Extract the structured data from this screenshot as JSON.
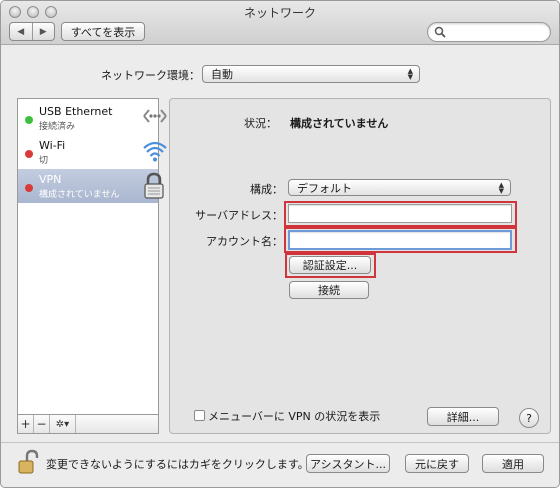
{
  "window": {
    "title": "ネットワーク"
  },
  "toolbar": {
    "show_all_label": "すべてを表示",
    "search_placeholder": ""
  },
  "location": {
    "label": "ネットワーク環境：",
    "value": "自動"
  },
  "sidebar": {
    "services": [
      {
        "name": "USB Ethernet",
        "status": "接続済み",
        "dot_color": "#3fbf3f",
        "icon": "ethernet-icon"
      },
      {
        "name": "Wi-Fi",
        "status": "切",
        "dot_color": "#d93a3a",
        "icon": "wifi-icon"
      },
      {
        "name": "VPN",
        "status": "構成されていません",
        "dot_color": "#d93a3a",
        "icon": "lock-icon",
        "selected": true
      }
    ],
    "add_label": "+",
    "remove_label": "−",
    "action_label": "✲▾"
  },
  "detail": {
    "status_label": "状況：",
    "status_value": "構成されていません",
    "config_label": "構成：",
    "config_value": "デフォルト",
    "server_label": "サーバアドレス：",
    "server_value": "",
    "account_label": "アカウント名：",
    "account_value": "",
    "auth_button": "認証設定...",
    "connect_button": "接続",
    "menubar_checkbox_label": "メニューバーに VPN の状況を表示",
    "menubar_checked": false,
    "advanced_button": "詳細...",
    "help_label": "?"
  },
  "footer": {
    "lock_text": "変更できないようにするにはカギをクリックします。",
    "assistant_button": "アシスタント...",
    "revert_button": "元に戻す",
    "apply_button": "適用"
  },
  "colors": {
    "highlight": "#d0343c",
    "selection": "#a9b6cf",
    "focus": "#6e9bd8"
  }
}
